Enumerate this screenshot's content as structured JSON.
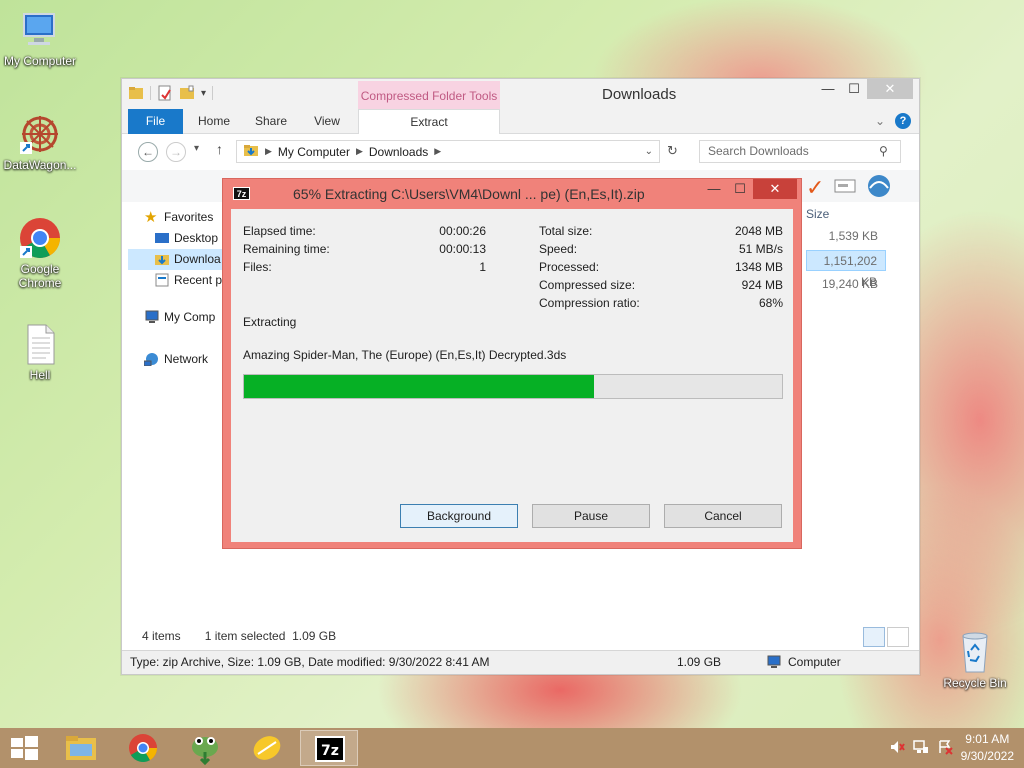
{
  "desktop": {
    "icons": [
      {
        "label": "My Computer"
      },
      {
        "label": "DataWagon..."
      },
      {
        "label": "Google Chrome"
      },
      {
        "label": "Hell"
      },
      {
        "label": "Recycle Bin"
      }
    ]
  },
  "explorer": {
    "title": "Downloads",
    "context_tab_header": "Compressed Folder Tools",
    "tabs": {
      "file": "File",
      "home": "Home",
      "share": "Share",
      "view": "View",
      "extract": "Extract"
    },
    "address": {
      "root": "My Computer",
      "folder": "Downloads"
    },
    "search_placeholder": "Search Downloads",
    "nav": {
      "favorites": "Favorites",
      "desktop": "Desktop",
      "downloads": "Downloa",
      "recent": "Recent p",
      "my_computer": "My Comp",
      "network": "Network"
    },
    "size_column": {
      "header": "Size",
      "values": [
        "1,539 KB",
        "1,151,202 KB",
        "19,240 KB"
      ]
    },
    "status": {
      "items": "4 items",
      "selected": "1 item selected  1.09 GB",
      "details": "Type: zip Archive, Size: 1.09 GB, Date modified: 9/30/2022 8:41 AM",
      "size": "1.09 GB",
      "location": "Computer"
    }
  },
  "dialog": {
    "logo": "7z",
    "title": "65% Extracting C:\\Users\\VM4\\Downl ... pe) (En,Es,It).zip",
    "progress_percent": 65,
    "labels": {
      "elapsed": "Elapsed time:",
      "remaining": "Remaining time:",
      "files": "Files:",
      "total_size": "Total size:",
      "speed": "Speed:",
      "processed": "Processed:",
      "compressed": "Compressed size:",
      "ratio": "Compression ratio:"
    },
    "values": {
      "elapsed": "00:00:26",
      "remaining": "00:00:13",
      "files": "1",
      "total_size": "2048 MB",
      "speed": "51 MB/s",
      "processed": "1348 MB",
      "compressed": "924 MB",
      "ratio": "68%"
    },
    "status": "Extracting",
    "current_file": "Amazing Spider-Man, The (Europe) (En,Es,It) Decrypted.3ds",
    "buttons": {
      "background": "Background",
      "pause": "Pause",
      "cancel": "Cancel"
    }
  },
  "taskbar": {
    "apps": [
      "file-explorer",
      "chrome",
      "frogger",
      "lemon",
      "7zip"
    ],
    "clock": {
      "time": "9:01 AM",
      "date": "9/30/2022"
    }
  },
  "colors": {
    "accent": "#1979ca",
    "progress": "#06b025",
    "dialog_frame": "#f0827a",
    "taskbar": "#b2916b",
    "context_tab": "#f8d3e2"
  }
}
